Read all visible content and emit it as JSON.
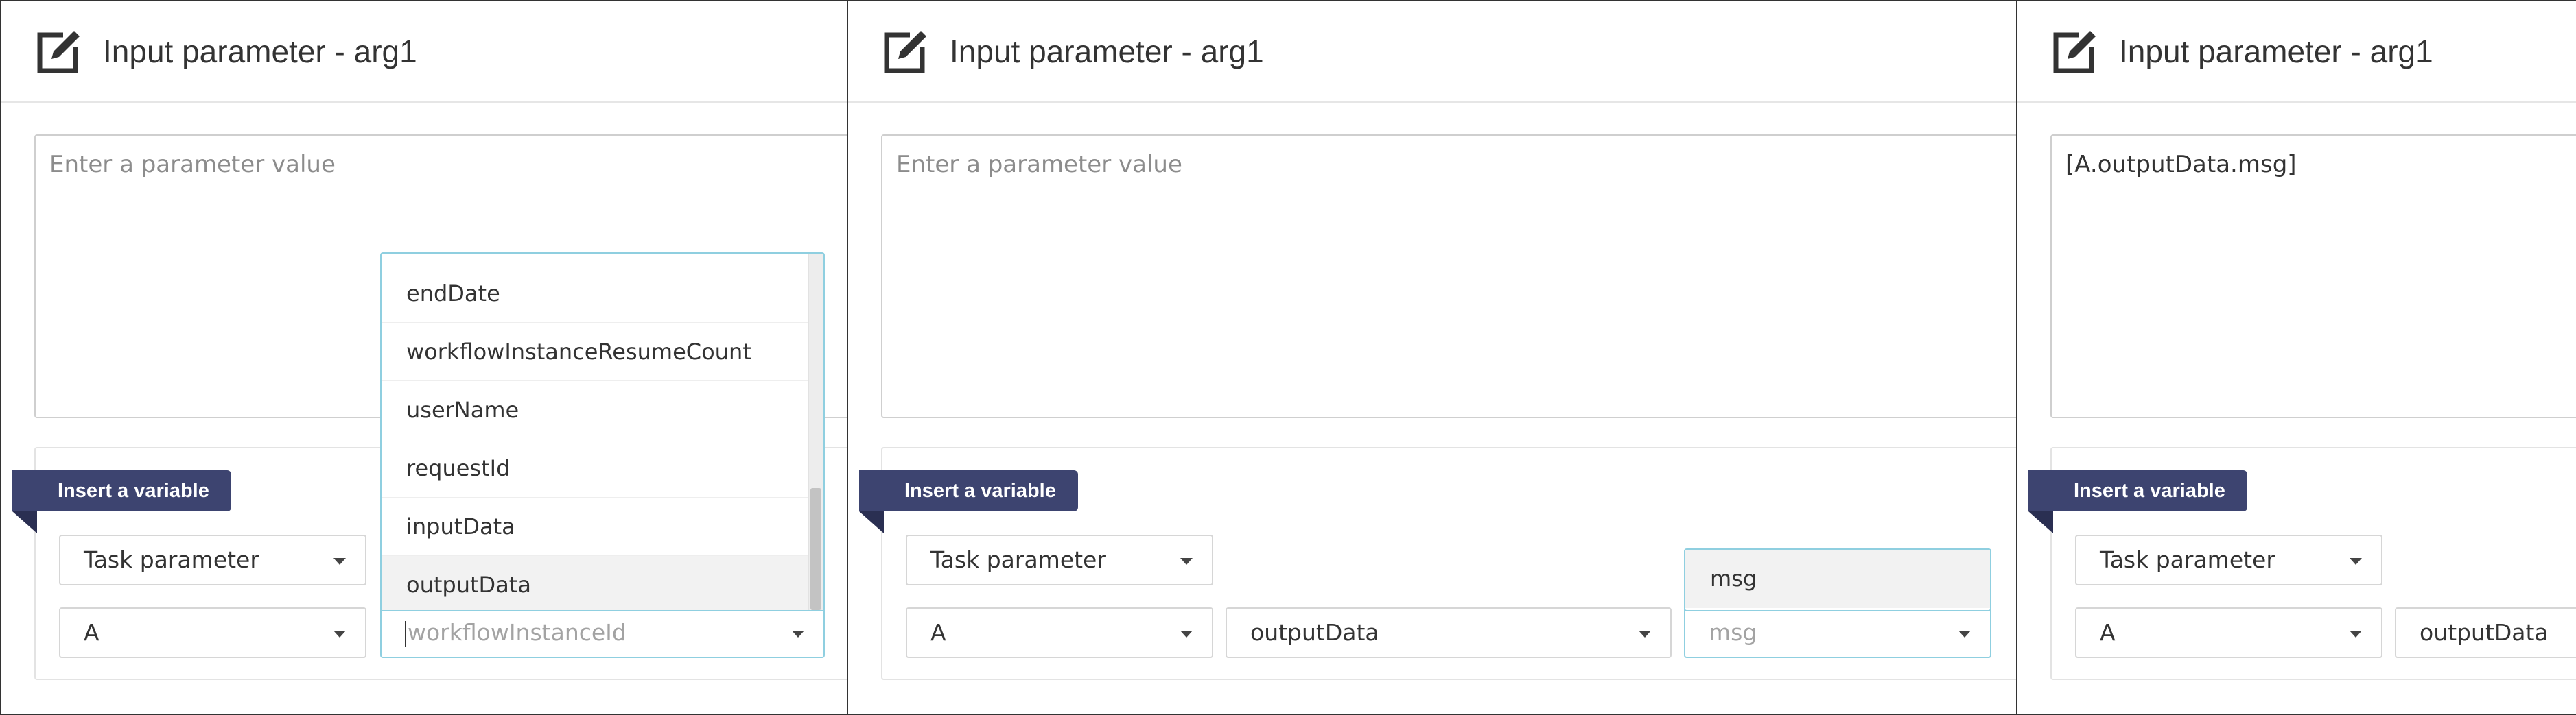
{
  "panels": [
    {
      "title": "Input parameter - arg1",
      "value": "",
      "value_placeholder": "Enter a parameter value",
      "insert_label": "Insert a variable",
      "type_select": "Task parameter",
      "task_select": "A",
      "field_select_placeholder": "workflowInstanceId",
      "dropdown_items": [
        "endDate",
        "workflowInstanceResumeCount",
        "userName",
        "requestId",
        "inputData",
        "outputData"
      ],
      "dropdown_highlight": "outputData"
    },
    {
      "title": "Input parameter - arg1",
      "value": "",
      "value_placeholder": "Enter a parameter value",
      "insert_label": "Insert a variable",
      "type_select": "Task parameter",
      "task_select": "A",
      "field_select": "outputData",
      "sub_select_placeholder": "msg",
      "dropdown_items": [
        "msg"
      ],
      "dropdown_highlight": "msg"
    },
    {
      "title": "Input parameter - arg1",
      "value": "[A.outputData.msg]",
      "insert_label": "Insert a variable",
      "type_select": "Task parameter",
      "task_select": "A",
      "field_select": "outputData"
    }
  ],
  "colors": {
    "ribbon": "#3d4470",
    "focus_border": "#8fcfe0",
    "border": "#333333"
  },
  "icons": {
    "header": "edit-icon",
    "select": "caret-down-icon"
  }
}
